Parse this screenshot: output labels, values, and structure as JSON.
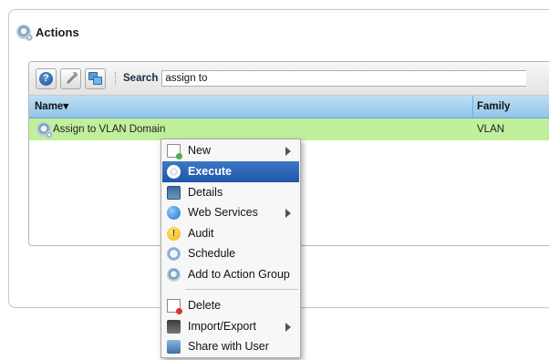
{
  "panel": {
    "title": "Actions"
  },
  "toolbar": {
    "search_label": "Search",
    "search_value": "assign to"
  },
  "table": {
    "columns": [
      "Name",
      "Family"
    ],
    "rows": [
      {
        "name": "Assign to VLAN Domain",
        "family": "VLAN"
      }
    ]
  },
  "context_menu": {
    "items": [
      {
        "label": "New",
        "icon": "new-document-icon",
        "submenu": true
      },
      {
        "label": "Execute",
        "icon": "execute-gear-icon",
        "highlighted": true
      },
      {
        "label": "Details",
        "icon": "details-monitor-icon"
      },
      {
        "label": "Web Services",
        "icon": "globe-icon",
        "submenu": true
      },
      {
        "label": "Audit",
        "icon": "audit-warning-icon"
      },
      {
        "label": "Schedule",
        "icon": "clock-icon"
      },
      {
        "label": "Add to Action Group",
        "icon": "action-group-gear-icon"
      },
      {
        "label": "Delete",
        "icon": "delete-document-icon"
      },
      {
        "label": "Import/Export",
        "icon": "import-export-icon",
        "submenu": true
      },
      {
        "label": "Share with User",
        "icon": "share-user-icon"
      }
    ]
  },
  "colors": {
    "row_highlight": "#c1f09c",
    "header_blue": "#8fc4ea",
    "menu_active": "#1f57a8"
  }
}
